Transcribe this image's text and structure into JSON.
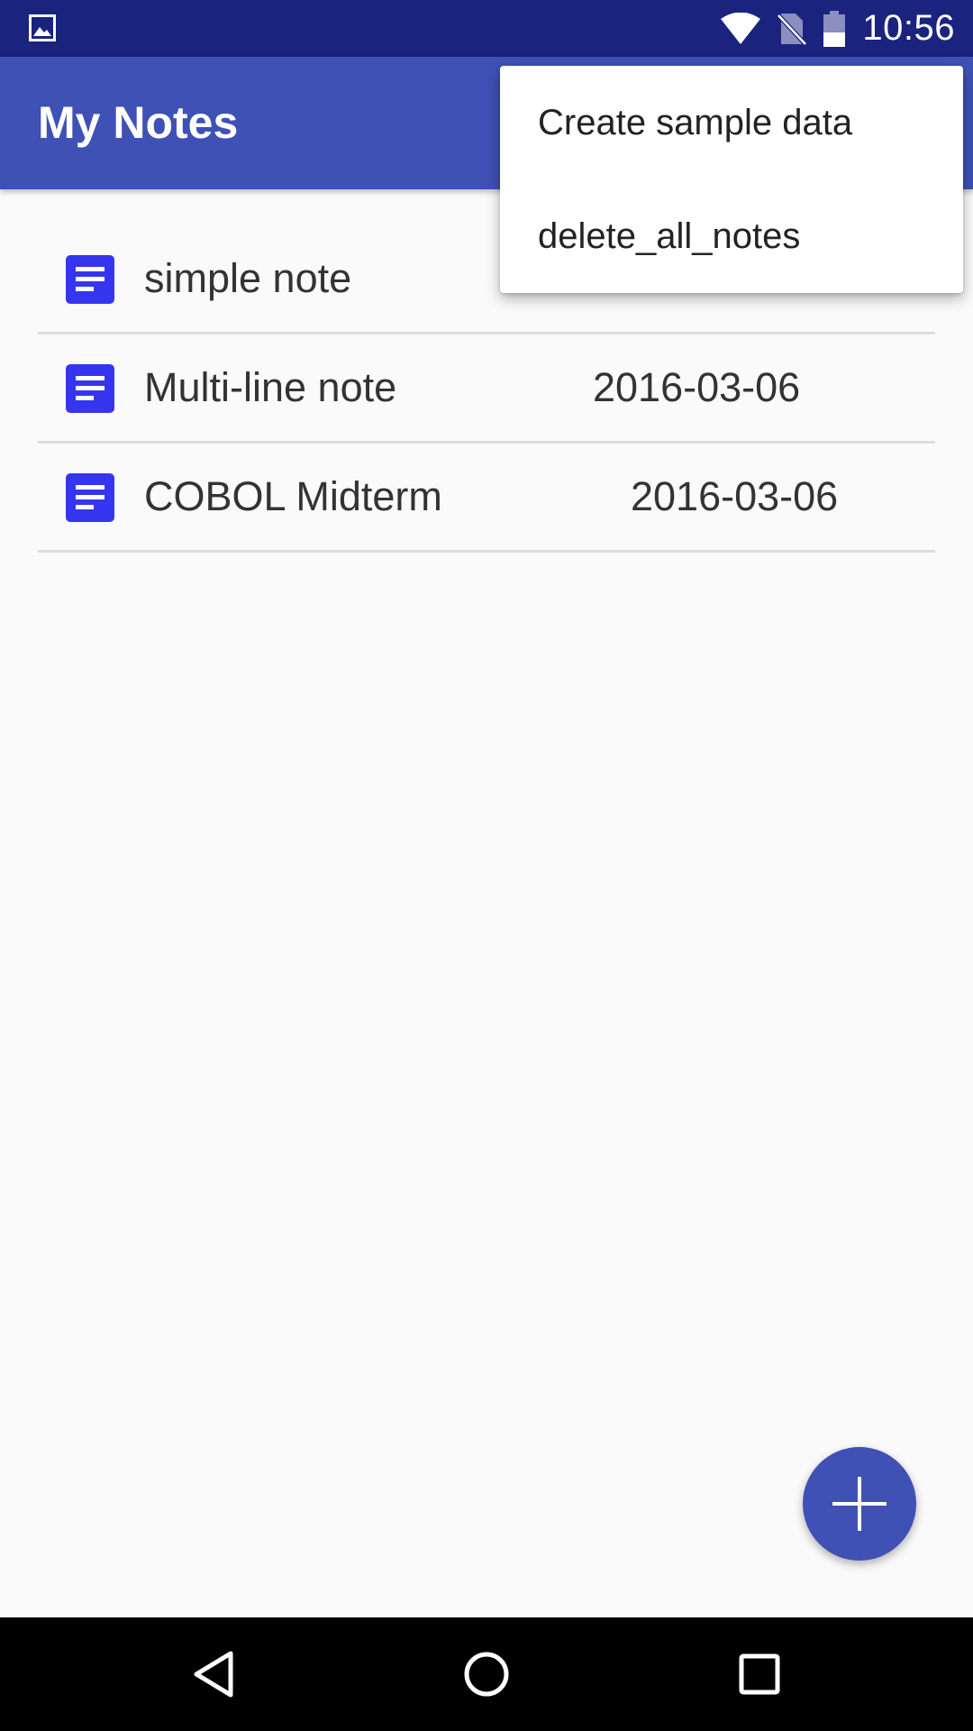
{
  "status_bar": {
    "time": "10:56",
    "left_icon": "image-notification-icon",
    "icons": [
      "wifi-icon",
      "no-sim-icon",
      "battery-icon"
    ],
    "background": "#1a237e"
  },
  "app_bar": {
    "title": "My Notes",
    "color": "#3f51b5"
  },
  "notes": [
    {
      "title": "simple note",
      "date": ""
    },
    {
      "title": "Multi-line note",
      "date": "2016-03-06"
    },
    {
      "title": "COBOL Midterm",
      "date": "2016-03-06"
    }
  ],
  "overflow_menu": {
    "items": [
      {
        "label": "Create sample data"
      },
      {
        "label": "delete_all_notes"
      }
    ]
  },
  "fab": {
    "icon": "plus-icon",
    "color": "#3f51b5"
  },
  "nav_bar": {
    "buttons": [
      "back-icon",
      "home-icon",
      "recents-icon"
    ]
  },
  "colors": {
    "note_icon": "#3535f0",
    "divider": "#dcdcdc"
  }
}
